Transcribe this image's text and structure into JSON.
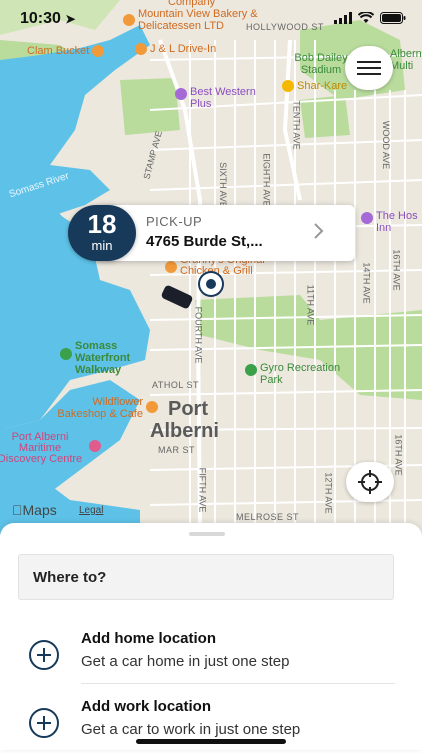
{
  "status_bar": {
    "time": "10:30"
  },
  "map": {
    "streets": [
      "HOLLYWOOD ST",
      "STAMP AVE",
      "SIXTH AVE",
      "EIGHTH AVE",
      "TENTH AVE",
      "WOOD AVE",
      "16TH AVE",
      "14TH AVE",
      "11TH AVE",
      "ATHOL ST",
      "MAR ST",
      "FIFTH AVE",
      "12TH AVE",
      "MELROSE ST",
      "16TH AVE",
      "FOURTH AVE",
      "Somass River"
    ],
    "places": [
      "Company",
      "Mountain View Bakery & Delicatessen LTD",
      "Clam Bucket",
      "J & L Drive-In",
      "Bob Dailey Stadium",
      "Alberni Multi",
      "Best Western Plus",
      "Shar-Kare",
      "The Hos Inn",
      "Granny's Original Chicken & Grill",
      "Somass Waterfront Walkway",
      "Gyro Recreation Park",
      "Wildflower Bakeshop & Cafe",
      "Port Alberni Maritime Discovery Centre"
    ],
    "city_label_line1": "Port",
    "city_label_line2": "Alberni",
    "attribution": "Maps",
    "legal": "Legal"
  },
  "pickup": {
    "eta_minutes": "18",
    "eta_unit": "min",
    "label": "PICK-UP",
    "address": "4765 Burde St,..."
  },
  "sheet": {
    "search_placeholder": "Where to?",
    "rows": [
      {
        "title": "Add home location",
        "subtitle": "Get a car home in just one step"
      },
      {
        "title": "Add work location",
        "subtitle": "Get a car to work in just one step"
      }
    ]
  },
  "colors": {
    "eta_badge": "#183a5a",
    "water": "#5ec2e8",
    "park": "#b9dc9d",
    "map_bg": "#ece8de"
  },
  "icons": [
    "navigation-arrow-icon",
    "signal-icon",
    "wifi-icon",
    "battery-icon",
    "menu-icon",
    "chevron-right-icon",
    "locate-icon",
    "add-icon",
    "car-icon",
    "pickup-pin-icon"
  ]
}
